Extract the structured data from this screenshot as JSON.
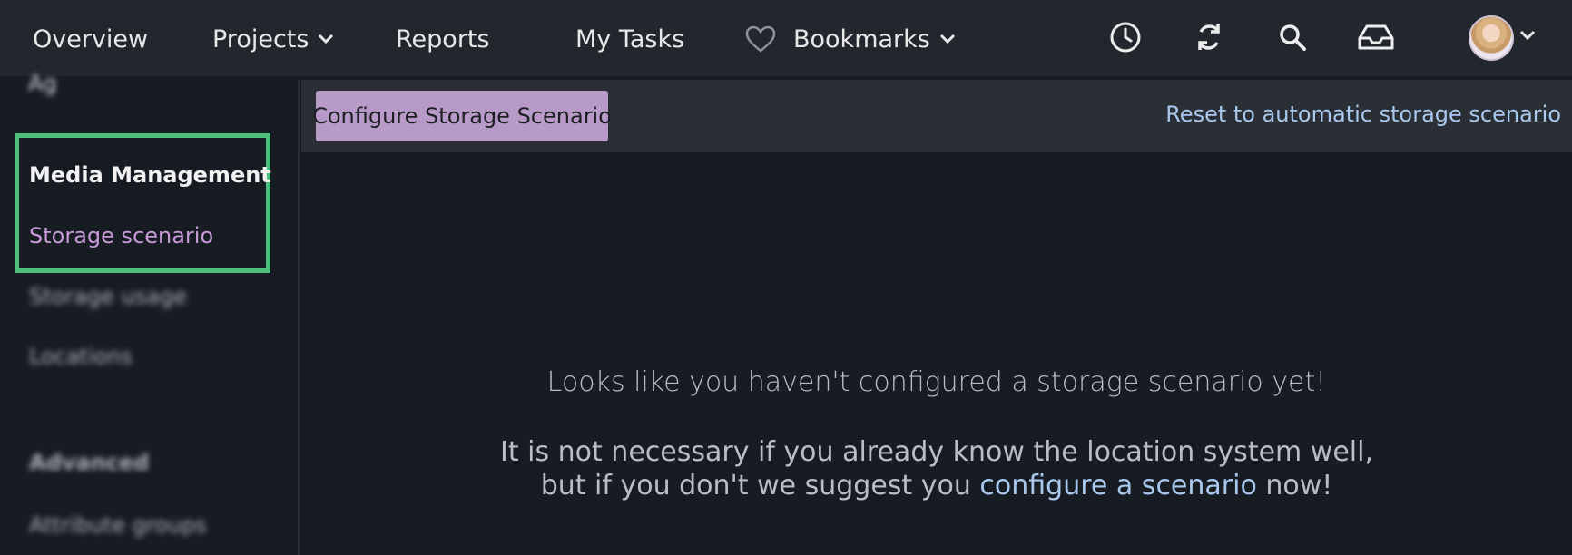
{
  "nav": {
    "overview": "Overview",
    "projects": "Projects",
    "reports": "Reports",
    "my_tasks": "My Tasks",
    "bookmarks": "Bookmarks",
    "icons": [
      "clock-icon",
      "sync-icon",
      "search-icon",
      "inbox-icon",
      "heart-icon",
      "chevron-down-icon"
    ]
  },
  "sidebar": {
    "partial_item": "Ag",
    "section_media": "Media Management",
    "active_item": "Storage scenario",
    "items": [
      "Storage usage",
      "Locations"
    ],
    "section_advanced": "Advanced",
    "advanced_items": [
      "Attribute groups"
    ]
  },
  "toolbar": {
    "configure_button": "Configure Storage Scenario",
    "reset_link": "Reset to automatic storage scenario"
  },
  "empty_state": {
    "title": "Looks like you haven't configured a storage scenario yet!",
    "line1": "It is not necessary if you already know the location system well,",
    "line2_before": "but if you don't we suggest you",
    "line2_link": "configure a scenario",
    "line2_after": "now!"
  },
  "colors": {
    "accent": "#b79ac7",
    "link": "#a9c8ee",
    "highlight": "#4cbf7f",
    "background": "#171b22",
    "topbar": "#22272e"
  }
}
